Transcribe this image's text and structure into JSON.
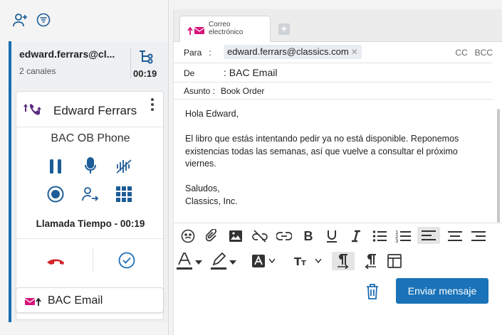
{
  "header_icons": [
    "add-user-icon",
    "filter-icon"
  ],
  "conversation": {
    "email": "edward.ferrars@cl...",
    "channels": "2 canales",
    "timer": "00:19",
    "transfer_icon": "flow-icon"
  },
  "call": {
    "contact_name": "Edward Ferrars",
    "phone_title": "BAC OB Phone",
    "call_time": "Llamada Tiempo - 00:19",
    "controls": [
      "pause-icon",
      "mic-icon",
      "mute-audio-icon",
      "record-icon",
      "transfer-user-icon",
      "keypad-icon"
    ],
    "hangup_color": "#d4242a",
    "accept_color": "#1d6fb8"
  },
  "email_item": {
    "label": "BAC Email"
  },
  "tab": {
    "label": "Correo electrónico"
  },
  "compose": {
    "to_label": "Para",
    "to_chip": "edward.ferrars@classics.com",
    "cc": "CC",
    "bcc": "BCC",
    "from_label": "De",
    "from_value": ": BAC Email",
    "subject_label": "Asunto :",
    "subject_value": "Book Order",
    "body": [
      "Hola Edward,",
      "El libro que estás intentando pedir ya no está disponible. Reponemos existencias todas las semanas, así que vuelve a consultar el próximo viernes.",
      "Saludos,",
      "Classics, Inc."
    ]
  },
  "send_button": "Enviar mensaje",
  "colors": {
    "accent": "#1a73b8",
    "email_pink": "#d6157a",
    "call_purple": "#5a2d82"
  }
}
